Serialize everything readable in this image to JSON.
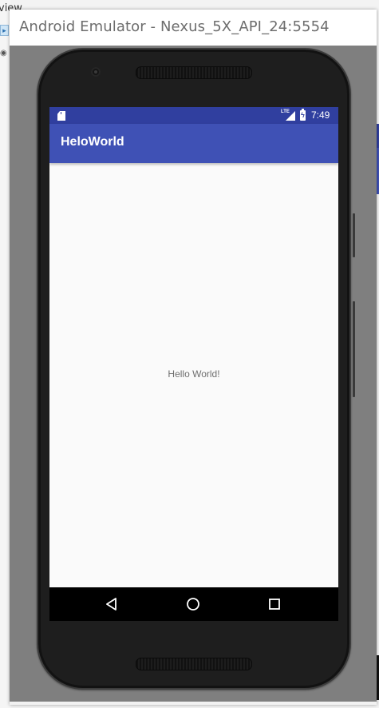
{
  "background": {
    "ide_text": "view"
  },
  "emulator": {
    "window_title": "Android Emulator - Nexus_5X_API_24:5554"
  },
  "status_bar": {
    "time": "7:49",
    "network_label": "LTE",
    "icons": [
      "sd-card-icon",
      "lte-signal-icon",
      "battery-charging-icon"
    ]
  },
  "app_bar": {
    "title": "HeloWorld"
  },
  "content": {
    "text": "Hello World!"
  },
  "nav_bar": {
    "buttons": [
      "back-icon",
      "home-icon",
      "recents-icon"
    ]
  },
  "colors": {
    "status_bar": "#303f9f",
    "app_bar": "#3f51b5",
    "screen_background": "#fafafa",
    "nav_bar": "#000000",
    "emulator_frame": "#7f7f7f"
  }
}
